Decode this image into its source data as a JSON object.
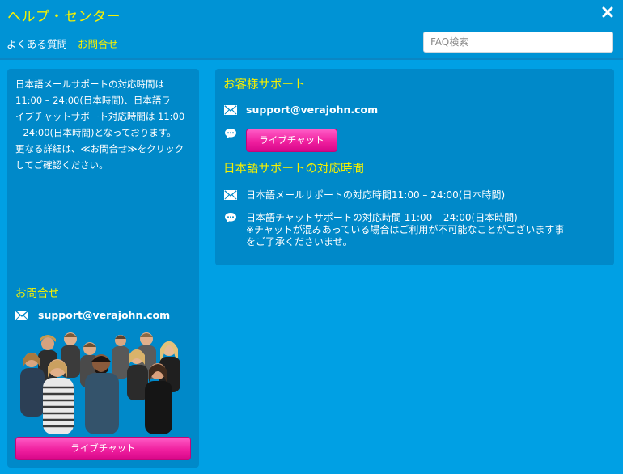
{
  "window": {
    "title": "ヘルプ・センター",
    "close_icon": "close-icon"
  },
  "nav": {
    "faq_label": "よくある質問",
    "contact_label": "お問合せ",
    "search_placeholder": "FAQ検索"
  },
  "left_panel": {
    "note_lines": [
      "日本語メールサポートの対応時間は",
      "11:00 – 24:00(日本時間)、日本語ラ",
      "イブチャットサポート対応時間は 11:00",
      "– 24:00(日本時間)となっております。",
      "更なる詳細は、≪お問合せ≫をクリック",
      "してご確認ください。"
    ],
    "contact_heading": "お問合せ",
    "email": "support@verajohn.com",
    "chat_button": "ライブチャット"
  },
  "right_panel": {
    "support_heading": "お客様サポート",
    "email": "support@verajohn.com",
    "chat_button": "ライブチャット",
    "hours_heading": "日本語サポートの対応時間",
    "mail_hours": "日本語メールサポートの対応時間11:00 – 24:00(日本時間)",
    "chat_hours_lines": [
      "日本語チャットサポートの対応時間 11:00 – 24:00(日本時間)",
      "※チャットが混みあっている場合はご利用が不可能なことがございます事",
      "をご了承くださいませ。"
    ]
  },
  "colors": {
    "background": "#0094d6",
    "panel": "#0089c9",
    "accent_yellow": "#f7f000",
    "button_pink": "#f0209f"
  }
}
